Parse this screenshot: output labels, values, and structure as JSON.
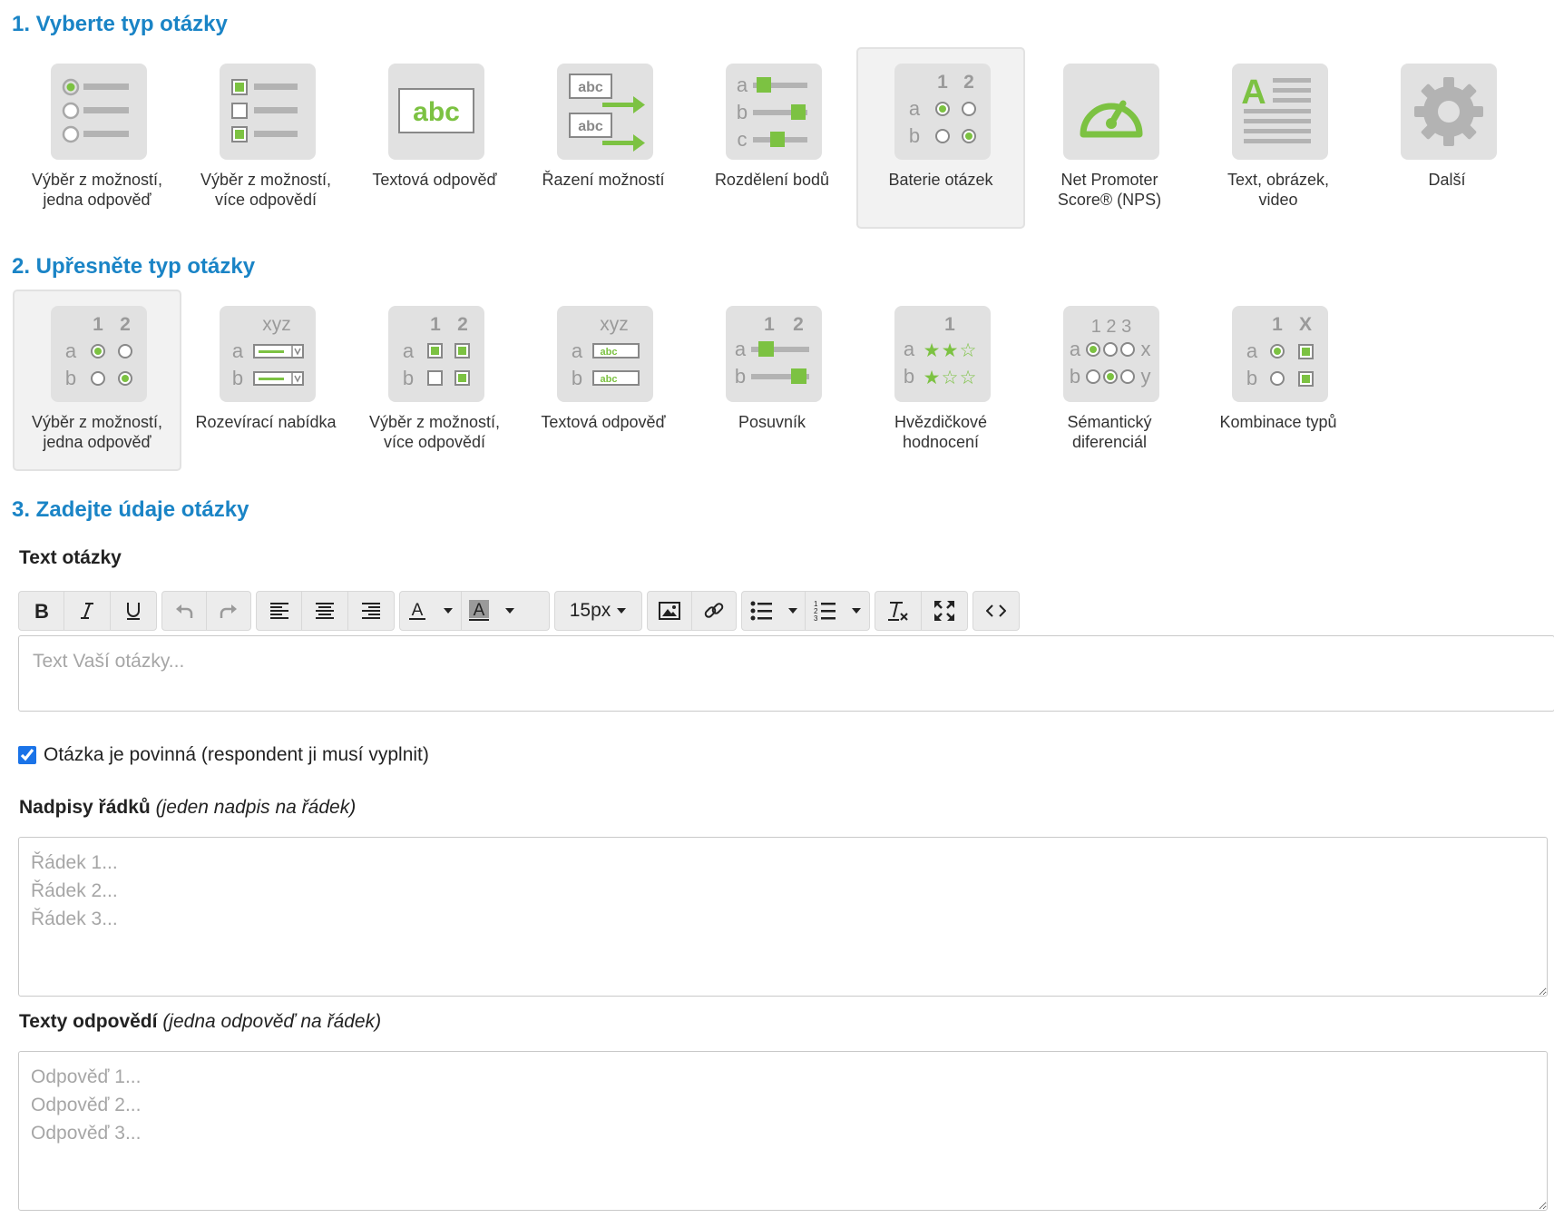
{
  "section1": {
    "title": "1. Vyberte typ otázky",
    "tiles": [
      {
        "label_l1": "Výběr z možností,",
        "label_l2": "jedna odpověď",
        "icon": "radio-list-icon"
      },
      {
        "label_l1": "Výběr z možností,",
        "label_l2": "více odpovědí",
        "icon": "checkbox-list-icon"
      },
      {
        "label_l1": "Textová odpověď",
        "label_l2": "",
        "icon": "text-answer-icon"
      },
      {
        "label_l1": "Řazení možností",
        "label_l2": "",
        "icon": "ranking-icon"
      },
      {
        "label_l1": "Rozdělení bodů",
        "label_l2": "",
        "icon": "point-distribution-icon"
      },
      {
        "label_l1": "Baterie otázek",
        "label_l2": "",
        "icon": "question-battery-icon",
        "selected": true
      },
      {
        "label_l1": "Net Promoter",
        "label_l2": "Score® (NPS)",
        "icon": "nps-gauge-icon"
      },
      {
        "label_l1": "Text, obrázek,",
        "label_l2": "video",
        "icon": "text-image-video-icon"
      },
      {
        "label_l1": "Další",
        "label_l2": "",
        "icon": "gear-icon"
      }
    ]
  },
  "section2": {
    "title": "2. Upřesněte typ otázky",
    "tiles": [
      {
        "label_l1": "Výběr z možností,",
        "label_l2": "jedna odpověď",
        "icon": "matrix-radio-icon",
        "selected": true
      },
      {
        "label_l1": "Rozevírací nabídka",
        "label_l2": "",
        "icon": "matrix-dropdown-icon"
      },
      {
        "label_l1": "Výběr z možností,",
        "label_l2": "více odpovědí",
        "icon": "matrix-checkbox-icon"
      },
      {
        "label_l1": "Textová odpověď",
        "label_l2": "",
        "icon": "matrix-text-icon"
      },
      {
        "label_l1": "Posuvník",
        "label_l2": "",
        "icon": "matrix-slider-icon"
      },
      {
        "label_l1": "Hvězdičkové",
        "label_l2": "hodnocení",
        "icon": "matrix-stars-icon"
      },
      {
        "label_l1": "Sémantický",
        "label_l2": "diferenciál",
        "icon": "semantic-differential-icon"
      },
      {
        "label_l1": "Kombinace typů",
        "label_l2": "",
        "icon": "matrix-combination-icon"
      }
    ]
  },
  "section3": {
    "title": "3. Zadejte údaje otázky",
    "question_text_label": "Text otázky",
    "editor_placeholder": "Text Vaší otázky...",
    "font_size": "15px",
    "required_label": "Otázka je povinná (respondent ji musí vyplnit)",
    "required_checked": true,
    "rows_label": "Nadpisy řádků",
    "rows_hint": "(jeden nadpis na řádek)",
    "rows_placeholder": "Řádek 1...\nŘádek 2...\nŘádek 3...",
    "answers_label": "Texty odpovědí",
    "answers_hint": "(jedna odpověď na řádek)",
    "answers_placeholder": "Odpověď 1...\nOdpověď 2...\nOdpověď 3..."
  },
  "colors": {
    "accent_green": "#7cc242",
    "icon_gray": "#b3b3b3",
    "title_blue": "#1a84c6"
  }
}
